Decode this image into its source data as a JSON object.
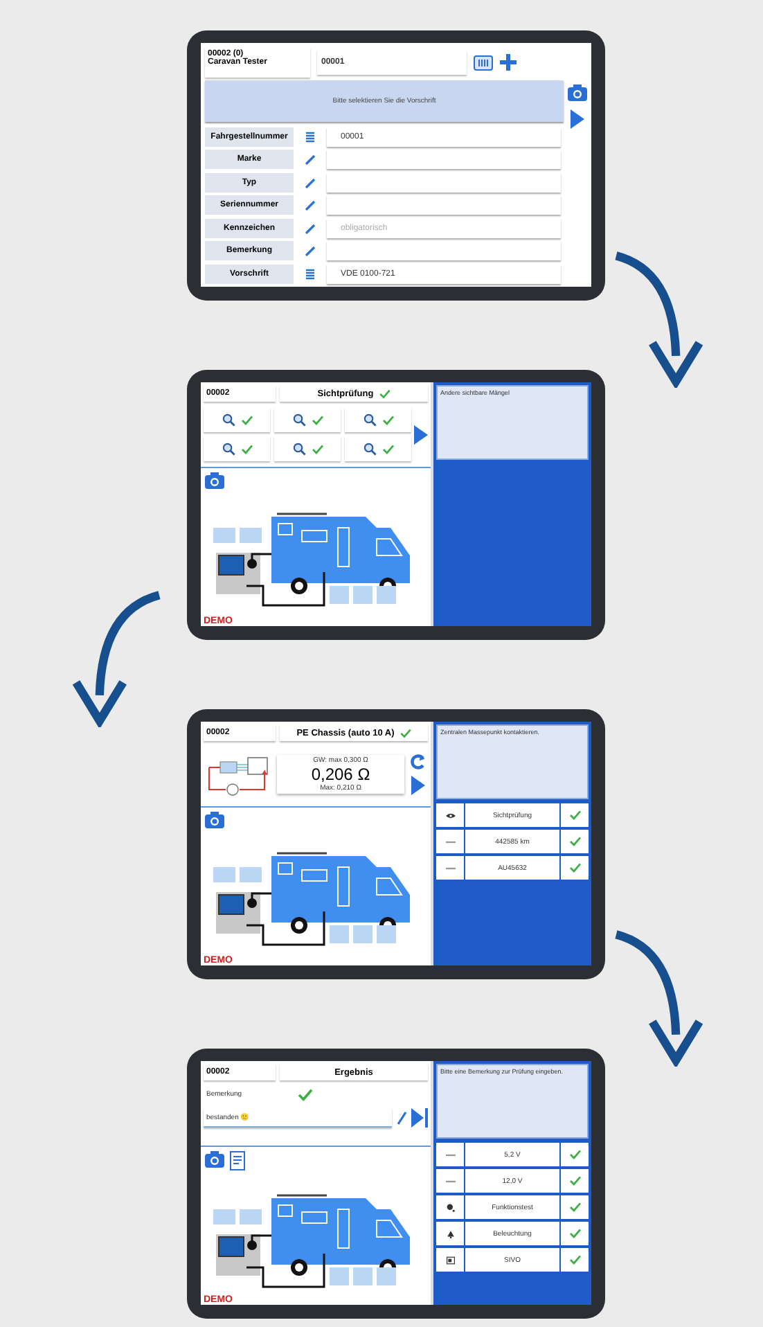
{
  "screens": [
    {
      "kind": "vehicle",
      "id_lines": [
        "00002 (0)",
        "Caravan Tester"
      ],
      "field_value": "00001",
      "prompt": "Bitte selektieren Sie die Vorschrift",
      "rows": [
        {
          "label": "Fahrgestellnummer",
          "kind": "list",
          "value": "00001"
        },
        {
          "label": "Marke",
          "kind": "edit"
        },
        {
          "label": "Typ",
          "kind": "edit"
        },
        {
          "label": "Seriennummer",
          "kind": "edit"
        },
        {
          "label": "Kennzeichen",
          "kind": "edit",
          "placeholder": "obligatorisch"
        },
        {
          "label": "Bemerkung",
          "kind": "edit"
        },
        {
          "label": "Vorschrift",
          "kind": "list",
          "value": "VDE 0100-721"
        }
      ]
    },
    {
      "kind": "visual",
      "number": "00002",
      "title": "Sichtprüfung",
      "done": true,
      "checks": [
        {
          "checked": true
        },
        {
          "checked": true
        },
        {
          "checked": true
        },
        {
          "checked": true
        },
        {
          "checked": true
        },
        {
          "checked": true
        }
      ],
      "note": "Andere sichtbare Mängel",
      "demo": "DEMO"
    },
    {
      "kind": "measure",
      "number": "00002",
      "title": "PE Chassis (auto 10 A)",
      "done": true,
      "limit": "GW: max 0,300 Ω",
      "value": "0,206 Ω",
      "max": "Max: 0,210 Ω",
      "note": "Zentralen Massepunkt kontaktieren.",
      "demo": "DEMO",
      "results": [
        {
          "kind": "eye",
          "label": "Sichtprüfung",
          "done": true
        },
        {
          "kind": "tag",
          "label": "442585 km",
          "done": true
        },
        {
          "kind": "tag",
          "label": "AU45632",
          "done": true
        }
      ]
    },
    {
      "kind": "result",
      "number": "00002",
      "title": "Ergebnis",
      "done": true,
      "remark_label": "Bemerkung",
      "remark": "bestanden 🙂",
      "note": "Bitte eine Bemerkung zur Prüfung eingeben.",
      "demo": "DEMO",
      "results": [
        {
          "kind": "tag",
          "label": "5,2 V",
          "done": true
        },
        {
          "kind": "tag",
          "label": "12,0 V",
          "done": true
        },
        {
          "kind": "sensor",
          "label": "Funktionstest",
          "done": true
        },
        {
          "kind": "lamp",
          "label": "Beleuchtung",
          "done": true
        },
        {
          "kind": "device",
          "label": "SIVO",
          "done": true
        }
      ]
    }
  ]
}
